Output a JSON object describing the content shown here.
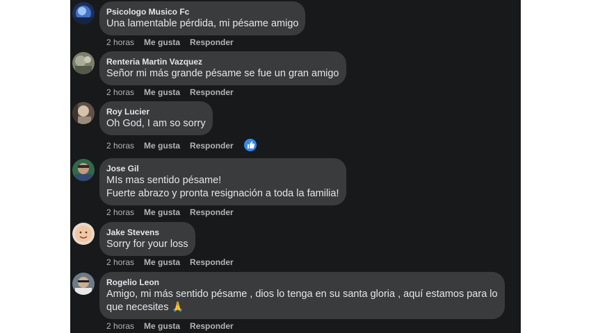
{
  "comments": [
    {
      "author": "Psicologo Musico Fc",
      "lines": [
        "Una lamentable pérdida, mi pésame amigo"
      ],
      "time": "2 horas",
      "like": "Me gusta",
      "reply": "Responder"
    },
    {
      "author": "Renteria Martin Vazquez",
      "lines": [
        "Señor mi más grande pésame se fue un gran amigo"
      ],
      "time": "2 horas",
      "like": "Me gusta",
      "reply": "Responder"
    },
    {
      "author": "Roy Lucier",
      "lines": [
        "Oh God, I am so sorry"
      ],
      "time": "2 horas",
      "like": "Me gusta",
      "reply": "Responder",
      "reaction": "like-icon"
    },
    {
      "author": "Jose Gil",
      "lines": [
        "MIs mas sentido pésame!",
        "Fuerte abrazo y pronta resignación a toda la familia!"
      ],
      "time": "2 horas",
      "like": "Me gusta",
      "reply": "Responder"
    },
    {
      "author": "Jake Stevens",
      "lines": [
        "Sorry for your loss"
      ],
      "time": "2 horas",
      "like": "Me gusta",
      "reply": "Responder"
    },
    {
      "author": "Rogelio Leon",
      "lines": [
        "Amigo, mi más sentido pésame , dios lo tenga en su santa gloria , aquí estamos para lo",
        "que necesites 🙏"
      ],
      "time": "2 horas",
      "like": "Me gusta",
      "reply": "Responder"
    }
  ],
  "colors": {
    "background": "#18191a",
    "bubble": "#3a3b3c",
    "text": "#e4e6eb",
    "secondary": "#b0b3b8",
    "like_blue": "#2e89ff"
  }
}
